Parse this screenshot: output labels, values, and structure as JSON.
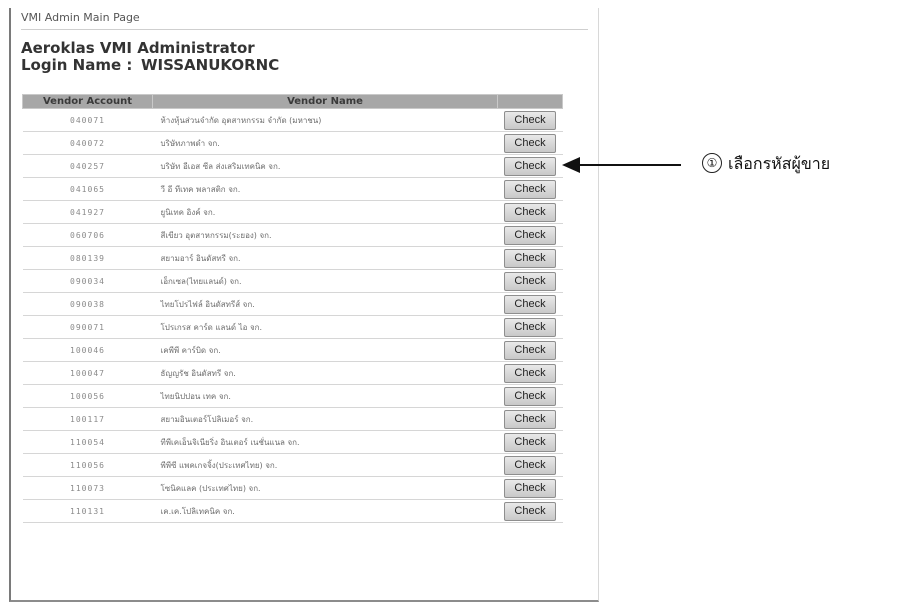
{
  "window": {
    "title": "VMI Admin Main Page"
  },
  "header": {
    "app_title": "Aeroklas VMI Administrator",
    "login_label": "Login Name :",
    "login_value": "WISSANUKORNC"
  },
  "table": {
    "columns": [
      "Vendor Account",
      "Vendor Name",
      ""
    ],
    "check_label": "Check",
    "rows": [
      {
        "account": "040071",
        "name": "ห้างหุ้นส่วนจำกัด อุตสาหกรรม จำกัด (มหาชน)"
      },
      {
        "account": "040072",
        "name": "บริษัทภาพดำ จก."
      },
      {
        "account": "040257",
        "name": "บริษัท อีเอส ซีล ส่งเสริมเทคนิค จก."
      },
      {
        "account": "041065",
        "name": "วี อี ทีเทค พลาสติก จก."
      },
      {
        "account": "041927",
        "name": "ยูนิเทค อิงค์ จก."
      },
      {
        "account": "060706",
        "name": "สีเขียว อุตสาหกรรม(ระยอง) จก."
      },
      {
        "account": "080139",
        "name": "สยามอาร์ อินดัสทรี จก."
      },
      {
        "account": "090034",
        "name": "เอ็กเซล(ไทยแลนด์) จก."
      },
      {
        "account": "090038",
        "name": "ไทยโปรไฟล์ อินดัสทรีส์ จก."
      },
      {
        "account": "090071",
        "name": "โปรเกรส คาร์ด แลนด์ ไอ จก."
      },
      {
        "account": "100046",
        "name": "เคพีพี คาร์บิด จก."
      },
      {
        "account": "100047",
        "name": "ธัญญรัช อินดัสทรี จก."
      },
      {
        "account": "100056",
        "name": "ไทยนิปปอน เทค จก."
      },
      {
        "account": "100117",
        "name": "สยามอินเตอร์โปลิเมอร์ จก."
      },
      {
        "account": "110054",
        "name": "ทีพีเคเอ็นจิเนียริ่ง อินเตอร์ เนชั่นแนล จก."
      },
      {
        "account": "110056",
        "name": "พีพีซี แพคเกจจิ้ง(ประเทศไทย) จก."
      },
      {
        "account": "110073",
        "name": "โซนิคแลค (ประเทศไทย) จก."
      },
      {
        "account": "110131",
        "name": "เค.เค.โปลิเทคนิค จก."
      }
    ]
  },
  "annotation": {
    "step_number": "①",
    "text": "เลือกรหัสผู้ขาย"
  }
}
